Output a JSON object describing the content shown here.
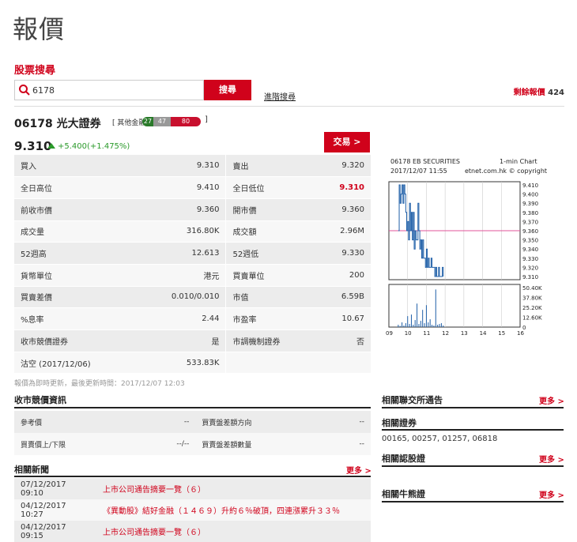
{
  "page": {
    "title": "報價"
  },
  "search": {
    "section_title": "股票搜尋",
    "value": "6178",
    "button_label": "搜尋",
    "advanced_label": "進階搜尋",
    "realtime_label": "剩餘報價",
    "realtime_count": "424"
  },
  "stock": {
    "code_name": "06178 光大證券",
    "sector": "[ 其他金融",
    "badges": [
      "27",
      "47",
      "80"
    ],
    "bracket_close": "]",
    "price": "9.310",
    "change": "+5.400(+1.475%)",
    "trade_label": "交易 >"
  },
  "quote_rows": [
    {
      "l1": "買入",
      "v1": "9.310",
      "l2": "賣出",
      "v2": "9.320"
    },
    {
      "l1": "全日高位",
      "v1": "9.410",
      "l2": "全日低位",
      "v2": "9.310"
    },
    {
      "l1": "前收市價",
      "v1": "9.360",
      "l2": "開市價",
      "v2": "9.360"
    },
    {
      "l1": "成交量",
      "v1": "316.80K",
      "l2": "成交額",
      "v2": "2.96M"
    },
    {
      "l1": "52週高",
      "v1": "12.613",
      "l2": "52週低",
      "v2": "9.330"
    },
    {
      "l1": "貨幣單位",
      "v1": "港元",
      "l2": "買賣單位",
      "v2": "200"
    },
    {
      "l1": "買賣差價",
      "v1": "0.010/0.010",
      "l2": "市值",
      "v2": "6.59B"
    },
    {
      "l1": "%息率",
      "v1": "2.44",
      "l2": "市盈率",
      "v2": "10.67"
    },
    {
      "l1": "收市競價證券",
      "v1": "是",
      "l2": "市調機制證券",
      "v2": "否"
    },
    {
      "l1": "沽空 (2017/12/06)",
      "v1": "533.83K",
      "l2": "",
      "v2": ""
    }
  ],
  "note": "報價為即時更新，最後更新時間：2017/12/07 12:03",
  "auction": {
    "title": "收市競價資訊",
    "rows": [
      {
        "l1": "參考價",
        "v1": "--",
        "l2": "買賣盤差額方向",
        "v2": "--"
      },
      {
        "l1": "買賣價上/下限",
        "v1": "--/--",
        "l2": "買賣盤差額數量",
        "v2": "--"
      }
    ]
  },
  "news": {
    "title": "相關新聞",
    "more": "更多 >",
    "items": [
      {
        "date": "07/12/2017 09:10",
        "headline": "上市公司通告摘要一覽（６）"
      },
      {
        "date": "04/12/2017 10:27",
        "headline": "《異動股》結好金融（１４６９）升約６％破頂，四連漲累升３３％"
      },
      {
        "date": "04/12/2017 09:15",
        "headline": "上市公司通告摘要一覽（６）"
      }
    ]
  },
  "chart": {
    "header_left": "06178 EB SECURITIES",
    "header_right": "1-min Chart",
    "sub_left": "2017/12/07  11:55",
    "sub_right": "etnet.com.hk © copyright",
    "price_ticks": [
      "9.410",
      "9.400",
      "9.390",
      "9.380",
      "9.370",
      "9.360",
      "9.350",
      "9.340",
      "9.330",
      "9.320",
      "9.310"
    ],
    "volume_ticks": [
      "50.40K",
      "37.80K",
      "25.20K",
      "12.60K",
      "0"
    ],
    "x_ticks": [
      "09",
      "10",
      "11",
      "12",
      "13",
      "14",
      "15",
      "16"
    ]
  },
  "chart_data": {
    "type": "line",
    "title": "06178 EB SECURITIES",
    "xlabel": "",
    "ylabel": "",
    "ylim": [
      9.31,
      9.41
    ],
    "prev_close": 9.36,
    "series": [
      {
        "t": [
          9.5,
          9.55,
          9.6,
          9.65,
          9.7,
          9.75,
          9.8,
          9.85,
          9.9,
          9.95,
          10.0,
          10.05,
          10.1,
          10.15,
          10.2,
          10.25,
          10.3,
          10.35,
          10.4,
          10.45,
          10.5,
          10.55,
          10.6,
          10.65,
          10.7,
          10.75,
          10.8,
          10.85,
          10.9,
          10.95,
          11.0,
          11.05,
          11.1,
          11.15,
          11.2,
          11.25,
          11.3,
          11.35,
          11.4,
          11.45,
          11.5,
          11.55,
          11.6,
          11.65,
          11.7,
          11.75,
          11.8,
          11.85,
          11.9
        ],
        "values": [
          9.36,
          9.41,
          9.39,
          9.4,
          9.41,
          9.39,
          9.41,
          9.4,
          9.38,
          9.36,
          9.37,
          9.35,
          9.39,
          9.36,
          9.38,
          9.35,
          9.38,
          9.34,
          9.36,
          9.35,
          9.35,
          9.39,
          9.36,
          9.34,
          9.35,
          9.33,
          9.35,
          9.33,
          9.33,
          9.32,
          9.34,
          9.32,
          9.33,
          9.32,
          9.32,
          9.33,
          9.32,
          9.32,
          9.32,
          9.31,
          9.32,
          9.31,
          9.31,
          9.32,
          9.31,
          9.31,
          9.31,
          9.32,
          9.31
        ]
      }
    ],
    "volume": {
      "t": [
        9.5,
        9.6,
        9.7,
        9.8,
        9.9,
        10.0,
        10.1,
        10.2,
        10.3,
        10.4,
        10.5,
        10.6,
        10.7,
        10.8,
        10.9,
        11.0,
        11.1,
        11.2,
        11.3,
        11.4,
        11.5,
        11.6,
        11.7,
        11.8,
        11.9
      ],
      "values": [
        3000,
        1500,
        6000,
        2000,
        5000,
        14000,
        4000,
        16000,
        3000,
        9000,
        30000,
        4000,
        8000,
        22000,
        5000,
        28000,
        6000,
        10000,
        3000,
        2000,
        48000,
        3000,
        4000,
        5000,
        2000
      ],
      "ylim": [
        0,
        50400
      ]
    }
  },
  "right_panel": {
    "exchange_title": "相關聯交所通告",
    "exchange_more": "更多 >",
    "related_title": "相關證券",
    "related_list": "00165, 00257, 01257, 06818",
    "warrants_title": "相關認股證",
    "warrants_more": "更多 >",
    "cbbc_title": "相關牛熊證",
    "cbbc_more": "更多 >"
  }
}
